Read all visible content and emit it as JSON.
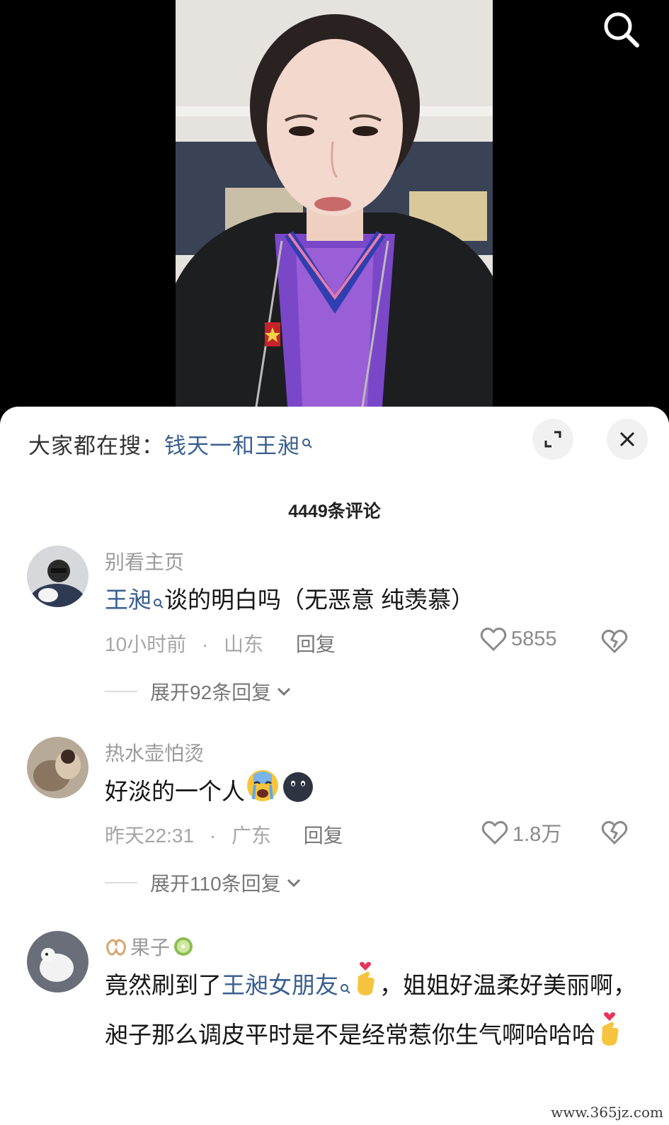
{
  "search_suggestion": {
    "prefix": "大家都在搜：",
    "keyword": "钱天一和王昶"
  },
  "comments_header": {
    "count_label": "4449条评论"
  },
  "comments": [
    {
      "username": "别看主页",
      "text_keyword": "王昶",
      "text": "谈的明白吗（无恶意 纯羡慕）",
      "time": "10小时前",
      "location": "山东",
      "reply_label": "回复",
      "likes": "5855",
      "expand_label": "展开92条回复"
    },
    {
      "username": "热水壶怕烫",
      "text": "好淡的一个人",
      "time": "昨天22:31",
      "location": "广东",
      "reply_label": "回复",
      "likes": "1.8万",
      "expand_label": "展开110条回复"
    },
    {
      "username": "果子",
      "text_before": "竟然刷到了",
      "text_keyword": "王昶女朋友",
      "text_after": "，姐姐好温柔好美丽啊，昶子那么调皮平时是不是经常惹你生气啊哈哈哈"
    }
  ],
  "watermark": "www.365jz.com",
  "colors": {
    "keyword_blue": "#3a5f8f",
    "sheet_bg": "#ffffff",
    "video_bg": "#000000"
  },
  "icons": {
    "search": "search-icon",
    "expand": "expand-icon",
    "close": "close-icon",
    "like": "heart-outline-icon",
    "dislike": "broken-heart-icon",
    "chevron": "chevron-down-icon"
  }
}
